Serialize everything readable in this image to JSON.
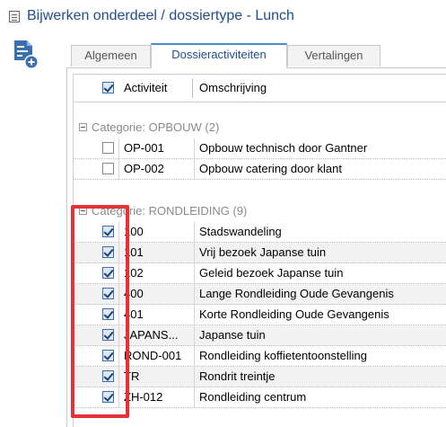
{
  "window": {
    "title": "Bijwerken onderdeel / dossiertype - Lunch"
  },
  "tabs": [
    {
      "label": "Algemeen"
    },
    {
      "label": "Dossieractiviteiten"
    },
    {
      "label": "Vertalingen"
    }
  ],
  "active_tab": "Dossieractiviteiten",
  "grid": {
    "headers": {
      "activity": "Activiteit",
      "description": "Omschrijving"
    },
    "header_checkbox_checked": true,
    "categories": [
      {
        "label": "Categorie:  OPBOUW (2)",
        "rows": [
          {
            "code": "OP-001",
            "description": "Opbouw technisch door Gantner",
            "checked": false
          },
          {
            "code": "OP-002",
            "description": "Opbouw catering door klant",
            "checked": false
          }
        ]
      },
      {
        "label": "Categorie:  RONDLEIDING (9)",
        "rows": [
          {
            "code": "100",
            "description": "Stadswandeling",
            "checked": true
          },
          {
            "code": "101",
            "description": "Vrij bezoek Japanse tuin",
            "checked": true
          },
          {
            "code": "102",
            "description": "Geleid bezoek Japanse tuin",
            "checked": true
          },
          {
            "code": "400",
            "description": "Lange Rondleiding Oude Gevangenis",
            "checked": true
          },
          {
            "code": "401",
            "description": "Korte Rondleiding Oude Gevangenis",
            "checked": true
          },
          {
            "code": "JAPANS...",
            "description": "Japanse tuin",
            "checked": true
          },
          {
            "code": "ROND-001",
            "description": "Rondleiding koffietentoonstelling",
            "checked": true
          },
          {
            "code": "TR",
            "description": "Rondrit treintje",
            "checked": true
          },
          {
            "code": "ZH-012",
            "description": "Rondleiding centrum",
            "checked": true
          }
        ]
      }
    ]
  },
  "colors": {
    "highlight": "#e53238",
    "title": "#1f4e8c",
    "tab_accent": "#4a8cd0"
  }
}
